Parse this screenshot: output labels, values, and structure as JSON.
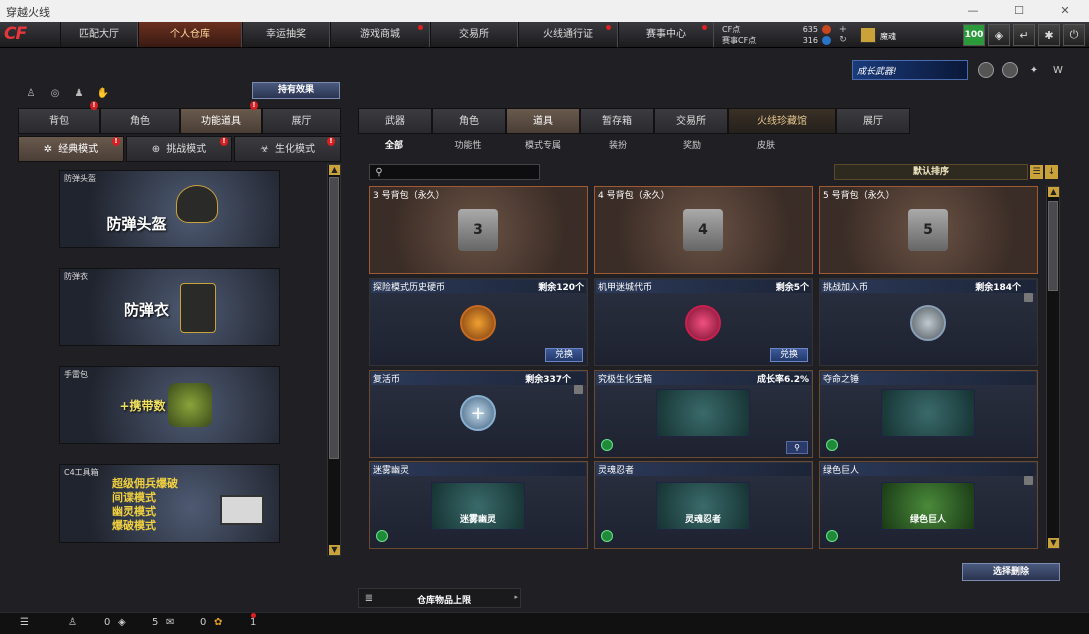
{
  "window": {
    "title": "穿越火线",
    "min": "—",
    "max": "☐",
    "close": "✕"
  },
  "nav": {
    "logo": "CF",
    "tabs": [
      {
        "label": "匹配大厅",
        "dot": false
      },
      {
        "label": "个人仓库",
        "dot": false,
        "active": true
      },
      {
        "label": "幸运抽奖",
        "dot": false
      },
      {
        "label": "游戏商城",
        "dot": true
      },
      {
        "label": "交易所",
        "dot": false
      },
      {
        "label": "火线通行证",
        "dot": true
      },
      {
        "label": "赛事中心",
        "dot": true
      }
    ],
    "cf_label": "CF点",
    "cf_value": "635",
    "match_cf_label": "赛事CF点",
    "match_cf_value": "316",
    "username": "魔魂",
    "level": "100"
  },
  "left": {
    "effect_button": "持有效果",
    "tabs": [
      "背包",
      "角色",
      "功能道具",
      "展厅"
    ],
    "modes": [
      "经典模式",
      "挑战模式",
      "生化模式"
    ],
    "cards": [
      {
        "caption": "防弹头盔",
        "big": "防弹头盔"
      },
      {
        "caption": "防弹衣",
        "big": "防弹衣"
      },
      {
        "caption": "手雷包",
        "big": "+携带数"
      },
      {
        "caption": "C4工具箱",
        "lines": [
          "超级佣兵爆破",
          "间谍模式",
          "幽灵模式",
          "爆破模式"
        ]
      }
    ]
  },
  "right": {
    "banner": "成长武器!",
    "tabs": [
      "武器",
      "角色",
      "道具",
      "暂存箱",
      "交易所",
      "火线珍藏馆",
      "展厅"
    ],
    "subtabs": [
      "全部",
      "功能性",
      "模式专属",
      "装扮",
      "奖励",
      "皮肤"
    ],
    "search_placeholder": "",
    "sort": "默认排序",
    "items": [
      {
        "name": "3 号背包（永久）",
        "bag": "3"
      },
      {
        "name": "4 号背包（永久）",
        "bag": "4"
      },
      {
        "name": "5 号背包（永久）",
        "bag": "5"
      },
      {
        "name": "探险模式历史硬币",
        "right": "剩余120个",
        "button": "兑换"
      },
      {
        "name": "机甲迷城代币",
        "right": "剩余5个",
        "button": "兑换"
      },
      {
        "name": "挑战加入币",
        "right": "剩余184个"
      },
      {
        "name": "复活币",
        "right": "剩余337个"
      },
      {
        "name": "究极生化宝箱",
        "right": "成长率6.2%"
      },
      {
        "name": "夺命之锤"
      },
      {
        "name": "迷雾幽灵",
        "art": "迷雾幽灵"
      },
      {
        "name": "灵魂忍者",
        "art": "灵魂忍者"
      },
      {
        "name": "绿色巨人",
        "art": "绿色巨人"
      }
    ],
    "select_delete": "选择删除",
    "capacity_label": "仓库物品上限"
  },
  "footer": {
    "v1": "0",
    "v2": "5",
    "v3": "0",
    "v4": "1"
  }
}
